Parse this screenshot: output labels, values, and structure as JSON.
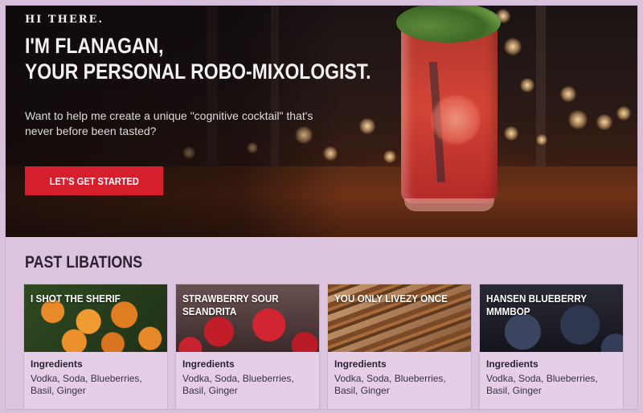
{
  "hero": {
    "eyebrow": "HI THERE.",
    "headline_line1": "I'M FLANAGAN,",
    "headline_line2": "YOUR PERSONAL ROBO-MIXOLOGIST.",
    "subtext": "Want to help me create a unique \"cognitive cocktail\" that's never before been tasted?",
    "cta_label": "LET'S GET STARTED"
  },
  "past_libations": {
    "title": "PAST LIBATIONS",
    "cards": [
      {
        "title": "I SHOT THE SHERIF",
        "ingredients_label": "Ingredients",
        "ingredients": "Vodka, Soda, Blueberries, Basil, Ginger"
      },
      {
        "title": "STRAWBERRY SOUR SEANDRITA",
        "ingredients_label": "Ingredients",
        "ingredients": "Vodka, Soda, Blueberries, Basil, Ginger"
      },
      {
        "title": "YOU ONLY LIVEZY ONCE",
        "ingredients_label": "Ingredients",
        "ingredients": "Vodka, Soda, Blueberries, Basil, Ginger"
      },
      {
        "title": "HANSEN BLUEBERRY MMMBOP",
        "ingredients_label": "Ingredients",
        "ingredients": "Vodka, Soda, Blueberries, Basil, Ginger"
      }
    ]
  },
  "colors": {
    "cta": "#d61f2c",
    "page_background": "#dcc4df"
  }
}
